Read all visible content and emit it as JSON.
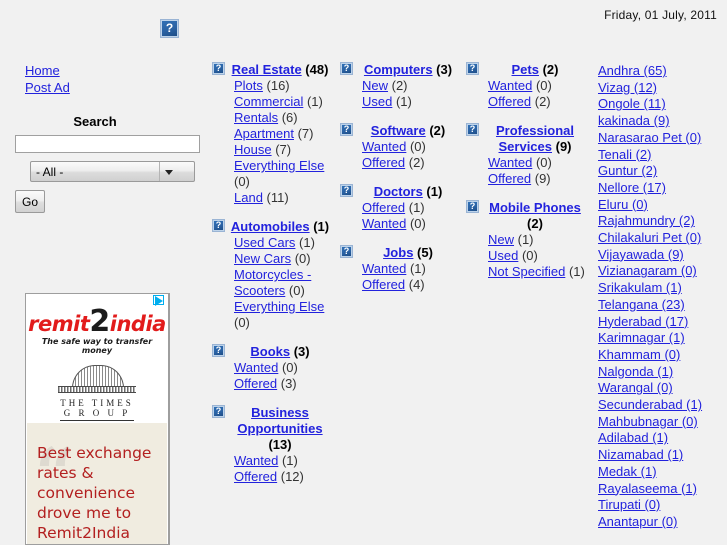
{
  "header": {
    "date": "Friday, 01 July, 2011",
    "logo_icon": "broken-image-icon"
  },
  "sidebar": {
    "nav": [
      {
        "label": "Home"
      },
      {
        "label": "Post Ad"
      }
    ],
    "search": {
      "title": "Search",
      "input_value": "",
      "input_placeholder": "",
      "select_value": "- All -",
      "select_options": [
        "- All -"
      ],
      "go_label": "Go"
    },
    "ad": {
      "brand_prefix": "remit",
      "brand_two": "2",
      "brand_suffix": "india",
      "tagline": "The safe way to transfer money",
      "group_line1": "THE  TIMES",
      "group_line2": "G R O U P",
      "quote": "Best exchange rates & convenience drove me to Remit2India",
      "quote_mark": "“",
      "adchoices_icon": "adchoices-icon"
    }
  },
  "categories": {
    "columns": [
      [
        {
          "icon": "broken-image-icon",
          "name": "Real Estate",
          "count": "(48)",
          "subs": [
            {
              "label": "Plots",
              "count": "(16)"
            },
            {
              "label": "Commercial",
              "count": "(1)"
            },
            {
              "label": "Rentals",
              "count": "(6)"
            },
            {
              "label": "Apartment",
              "count": "(7)"
            },
            {
              "label": "House",
              "count": "(7)"
            },
            {
              "label": "Everything Else",
              "count": "(0)"
            },
            {
              "label": "Land",
              "count": "(11)"
            }
          ]
        },
        {
          "icon": "broken-image-icon",
          "name": "Automobiles",
          "count": "(1)",
          "subs": [
            {
              "label": "Used Cars",
              "count": "(1)"
            },
            {
              "label": "New Cars",
              "count": "(0)"
            },
            {
              "label": "Motorcycles - Scooters",
              "count": "(0)"
            },
            {
              "label": "Everything Else",
              "count": "(0)"
            }
          ]
        },
        {
          "icon": "broken-image-icon",
          "name": "Books",
          "count": "(3)",
          "subs": [
            {
              "label": "Wanted",
              "count": "(0)"
            },
            {
              "label": "Offered",
              "count": "(3)"
            }
          ]
        },
        {
          "icon": "broken-image-icon",
          "name": "Business Opportunities",
          "count": "(13)",
          "subs": [
            {
              "label": "Wanted",
              "count": "(1)"
            },
            {
              "label": "Offered",
              "count": "(12)"
            }
          ]
        }
      ],
      [
        {
          "icon": "broken-image-icon",
          "name": "Computers",
          "count": "(3)",
          "subs": [
            {
              "label": "New",
              "count": "(2)"
            },
            {
              "label": "Used",
              "count": "(1)"
            }
          ]
        },
        {
          "icon": "broken-image-icon",
          "name": "Software",
          "count": "(2)",
          "subs": [
            {
              "label": "Wanted",
              "count": "(0)"
            },
            {
              "label": "Offered",
              "count": "(2)"
            }
          ]
        },
        {
          "icon": "broken-image-icon",
          "name": "Doctors",
          "count": "(1)",
          "subs": [
            {
              "label": "Offered",
              "count": "(1)"
            },
            {
              "label": "Wanted",
              "count": "(0)"
            }
          ]
        },
        {
          "icon": "broken-image-icon",
          "name": "Jobs",
          "count": "(5)",
          "subs": [
            {
              "label": "Wanted",
              "count": "(1)"
            },
            {
              "label": "Offered",
              "count": "(4)"
            }
          ]
        }
      ],
      [
        {
          "icon": "broken-image-icon",
          "name": "Pets",
          "count": "(2)",
          "subs": [
            {
              "label": "Wanted",
              "count": "(0)"
            },
            {
              "label": "Offered",
              "count": "(2)"
            }
          ]
        },
        {
          "icon": "broken-image-icon",
          "name": "Professional Services",
          "count": "(9)",
          "subs": [
            {
              "label": "Wanted",
              "count": "(0)"
            },
            {
              "label": "Offered",
              "count": "(9)"
            }
          ]
        },
        {
          "icon": "broken-image-icon",
          "name": "Mobile Phones",
          "count": "(2)",
          "subs": [
            {
              "label": "New",
              "count": "(1)"
            },
            {
              "label": "Used",
              "count": "(0)"
            },
            {
              "label": "Not Specified",
              "count": "(1)"
            }
          ]
        }
      ]
    ]
  },
  "locations": [
    "Andhra (65)",
    "Vizag (12)",
    "Ongole (11)",
    "kakinada (9)",
    "Narasarao Pet (0)",
    "Tenali (2)",
    "Guntur (2)",
    "Nellore (17)",
    "Eluru (0)",
    "Rajahmundry (2)",
    "Chilakaluri Pet (0)",
    "Vijayawada (9)",
    "Vizianagaram (0)",
    "Srikakulam (1)",
    "Telangana (23)",
    "Hyderabad (17)",
    "Karimnagar (1)",
    "Khammam (0)",
    "Nalgonda (1)",
    "Warangal (0)",
    "Secunderabad (1)",
    "Mahbubnagar (0)",
    "Adilabad (1)",
    "Nizamabad (1)",
    "Medak (1)",
    "Rayalaseema (1)",
    "Tirupati (0)",
    "Anantapur (0)"
  ],
  "colors": {
    "page_background": "#f1f1f1",
    "link": "#2222dd",
    "ad_red": "#b32020",
    "ad_panel": "#f0ece0",
    "icon_blue": "#2f6fb5"
  }
}
